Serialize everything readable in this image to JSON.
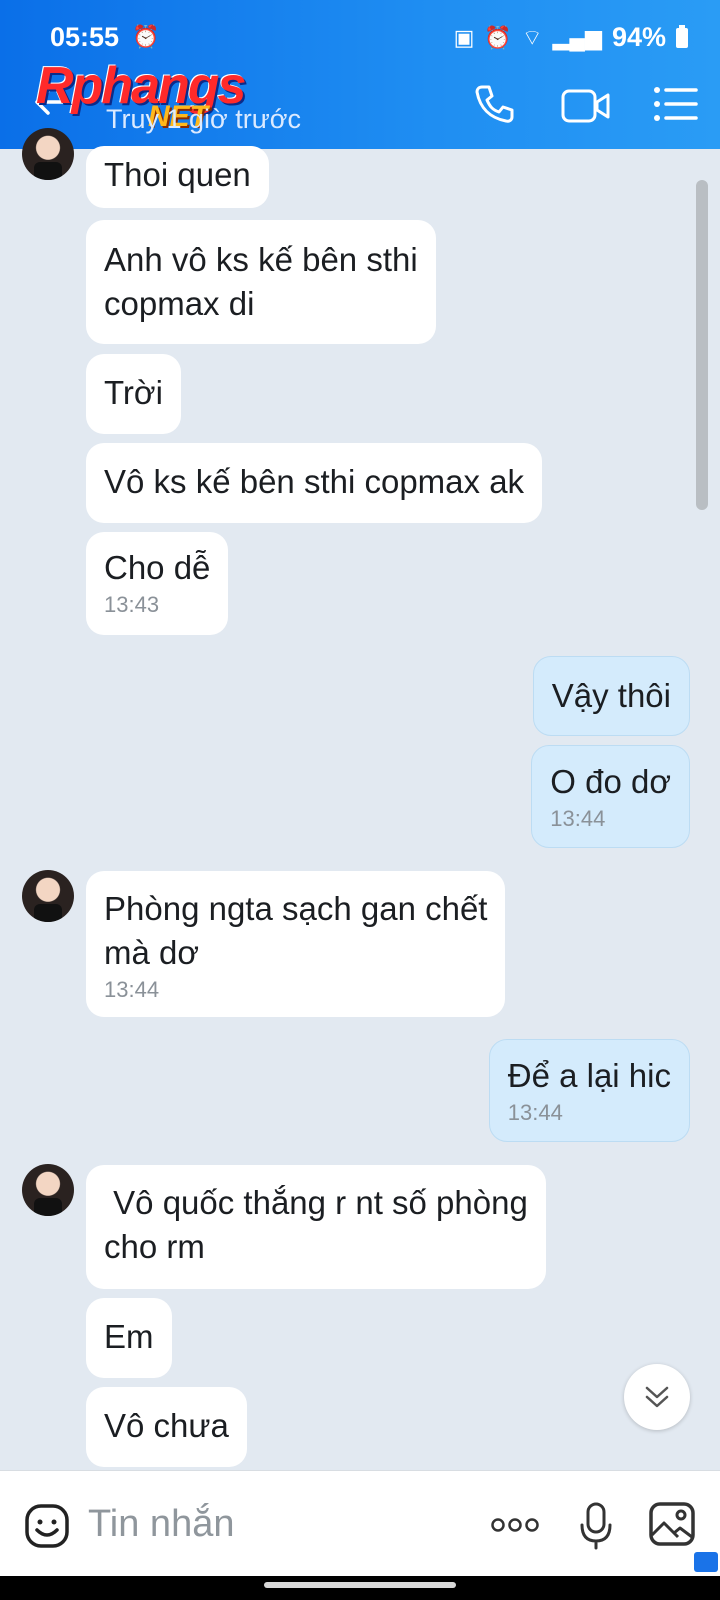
{
  "status_bar": {
    "time": "05:55",
    "battery": "94%"
  },
  "header": {
    "logo_main": "Rphangs",
    "logo_sub": "NET",
    "subtitle": "Truy   1 giờ trước"
  },
  "messages": [
    {
      "dir": "in",
      "text": "Thoi quen",
      "time": "",
      "avatar": true
    },
    {
      "dir": "in",
      "text": "Anh vô ks kế bên sthi\ncopmax di",
      "time": ""
    },
    {
      "dir": "in",
      "text": "Trời",
      "time": ""
    },
    {
      "dir": "in",
      "text": "Vô ks kế bên sthi copmax ak",
      "time": ""
    },
    {
      "dir": "in",
      "text": "Cho dễ",
      "time": "13:43"
    },
    {
      "dir": "out",
      "text": "Vậy thôi",
      "time": ""
    },
    {
      "dir": "out",
      "text": "O đo dơ",
      "time": "13:44"
    },
    {
      "dir": "in",
      "text": "Phòng ngta sạch gan chết\nmà dơ",
      "time": "13:44",
      "avatar": true
    },
    {
      "dir": "out",
      "text": "Để a lại hic",
      "time": "13:44"
    },
    {
      "dir": "in",
      "text": " Vô quốc thắng r nt số phòng\ncho rm",
      "time": "",
      "avatar": true
    },
    {
      "dir": "in",
      "text": "Em",
      "time": ""
    },
    {
      "dir": "in",
      "text": "Vô chưa",
      "time": ""
    }
  ],
  "input": {
    "placeholder": "Tin nhắn"
  },
  "icons": {
    "back": "arrow-left-icon",
    "call": "phone-icon",
    "video": "video-camera-icon",
    "menu": "list-menu-icon",
    "emoji": "emoji-icon",
    "more": "more-dots-icon",
    "mic": "microphone-icon",
    "image": "image-icon",
    "scroll_down": "double-chevron-down-icon"
  },
  "colors": {
    "header_gradient_start": "#0a6fe8",
    "header_gradient_end": "#2a9cf5",
    "background": "#e2e9f1",
    "incoming_bubble": "#ffffff",
    "outgoing_bubble": "#d4ebfc"
  }
}
